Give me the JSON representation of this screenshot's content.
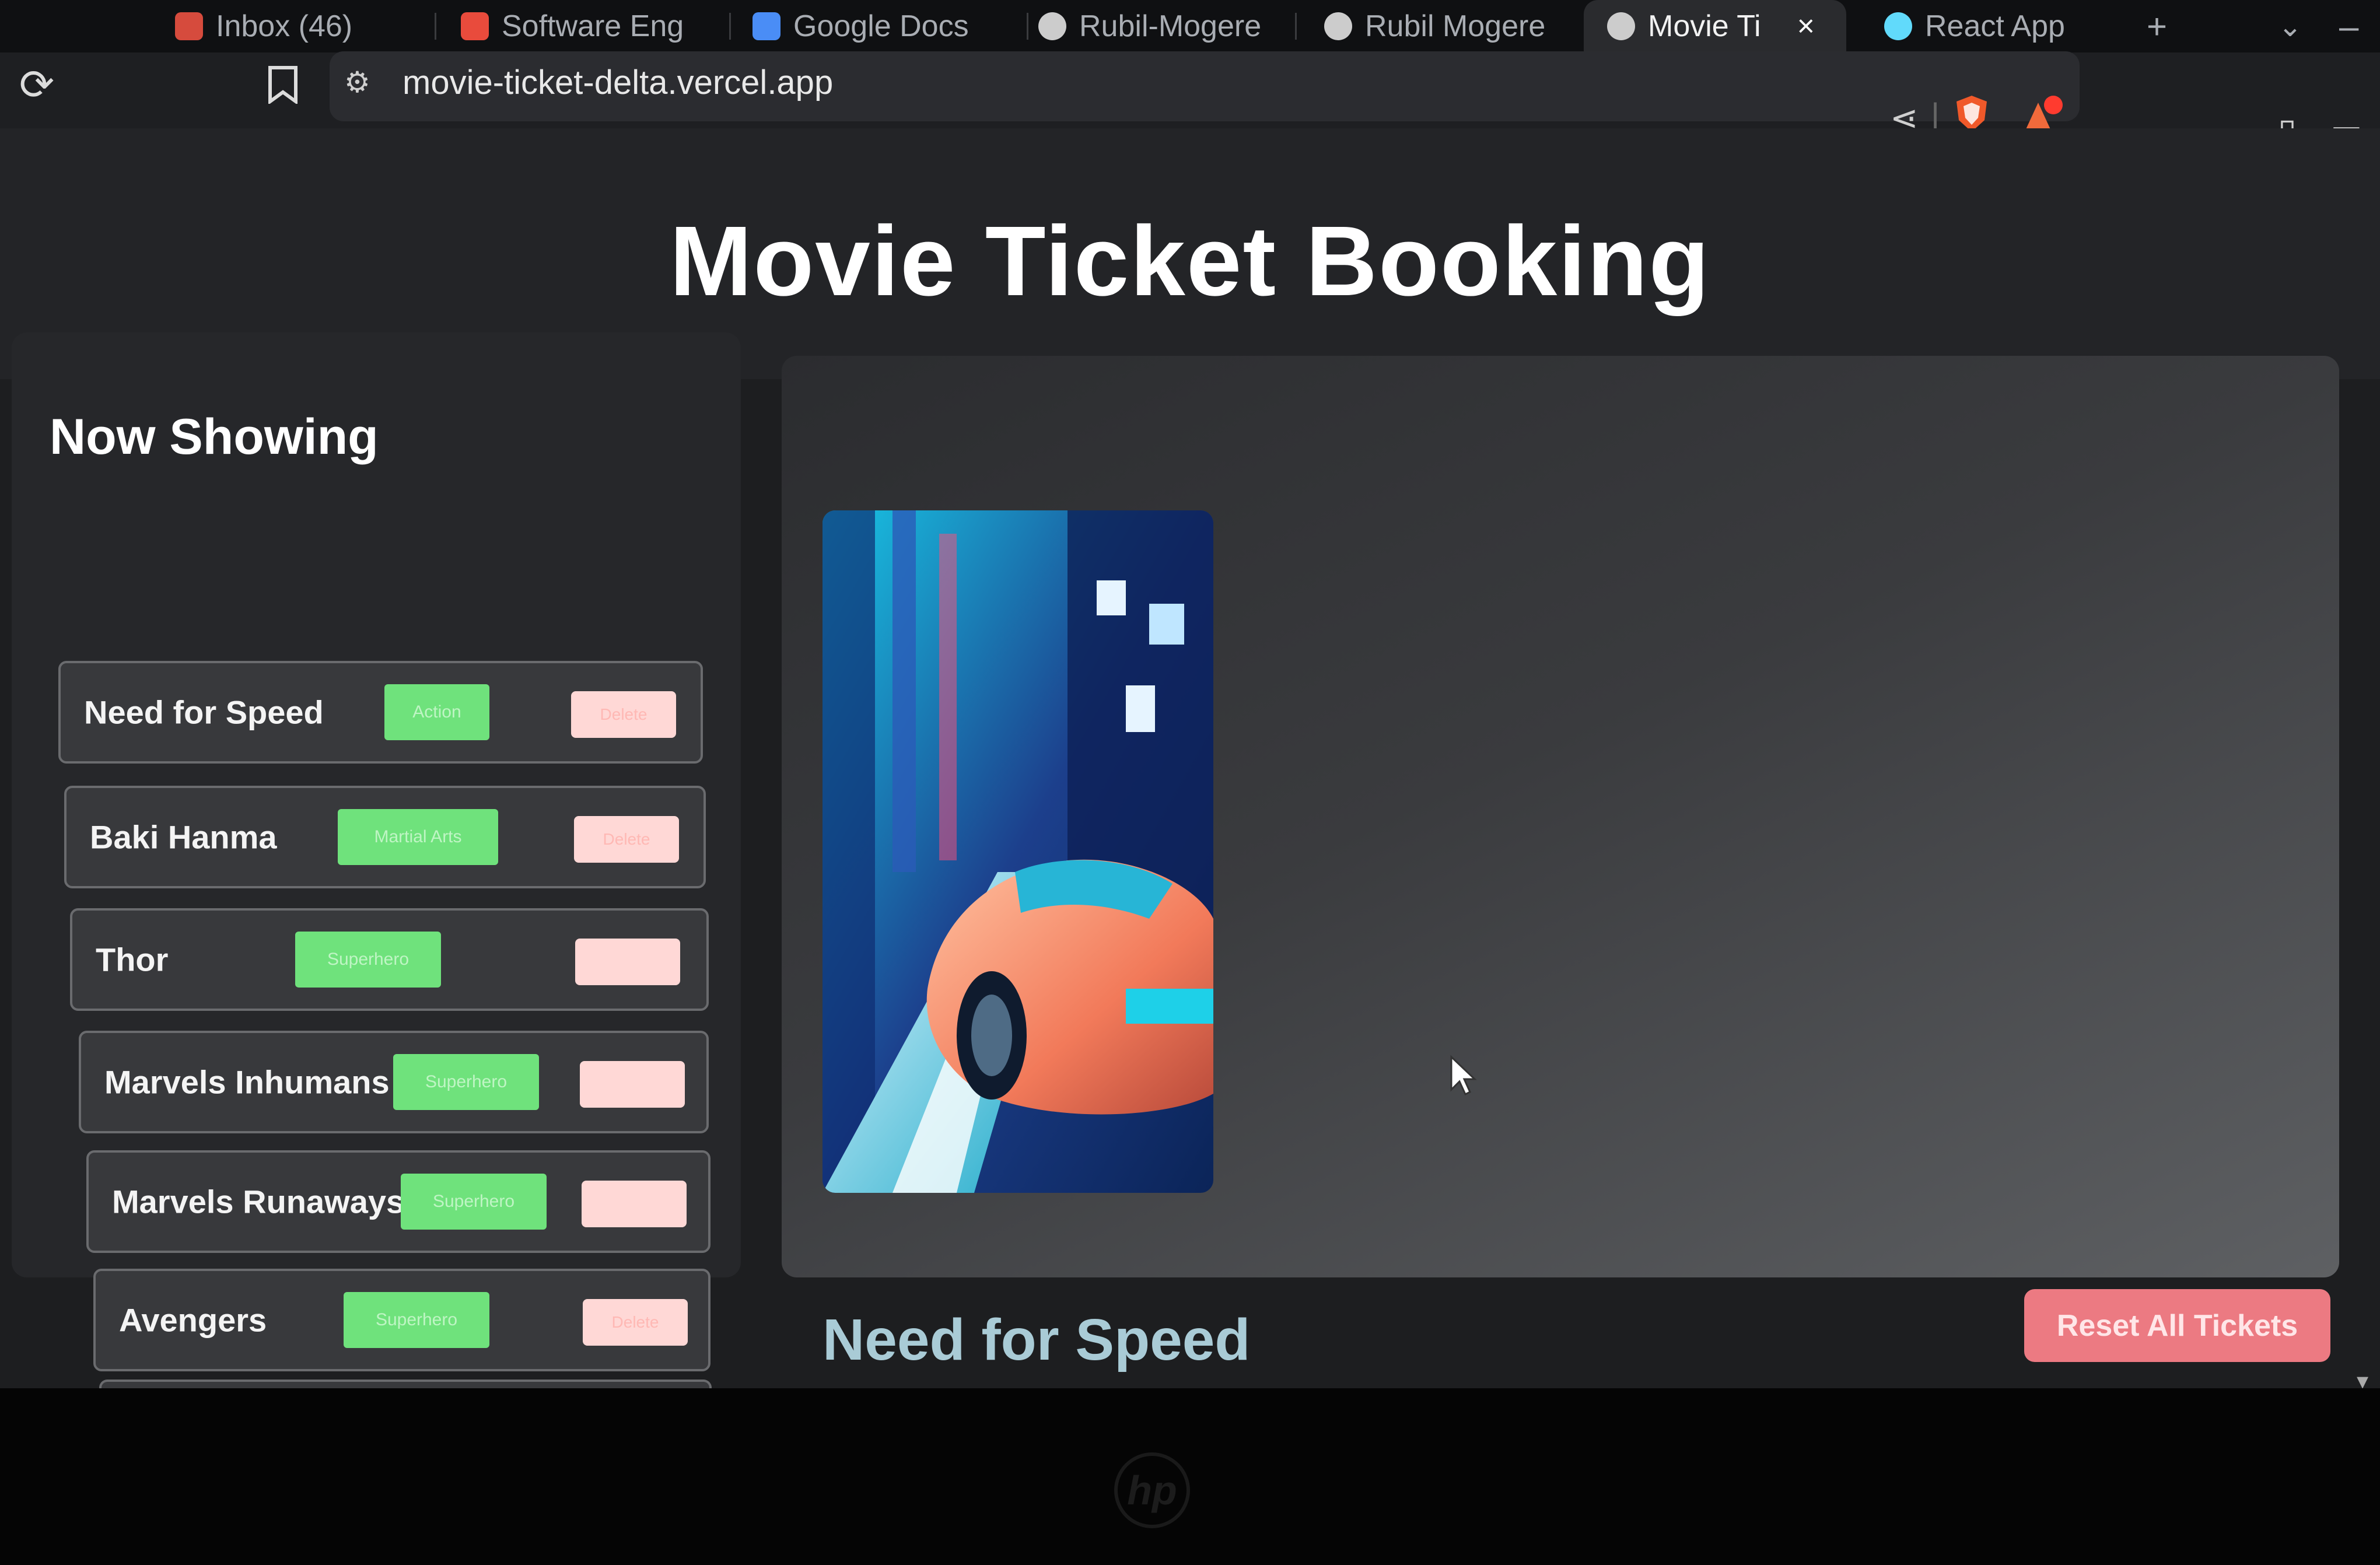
{
  "browser": {
    "tabs": [
      {
        "label": "Inbox (46)",
        "favicon": "gmail-icon",
        "color": "#d64b3d"
      },
      {
        "label": "Software Eng",
        "favicon": "app-icon",
        "color": "#e94b3c"
      },
      {
        "label": "Google Docs",
        "favicon": "docs-icon",
        "color": "#4a8df6"
      },
      {
        "label": "Rubil-Mogere",
        "favicon": "github-icon",
        "color": "#cccccc"
      },
      {
        "label": "Rubil Mogere",
        "favicon": "globe-icon",
        "color": "#cccccc"
      },
      {
        "label": "Movie Ti",
        "favicon": "globe-icon",
        "color": "#cccccc",
        "active": true
      },
      {
        "label": "React App",
        "favicon": "react-icon",
        "color": "#61dafb"
      }
    ],
    "new_tab": "+",
    "close_tab": "×",
    "url": "movie-ticket-delta.vercel.app"
  },
  "page": {
    "title": "Movie Ticket Booking",
    "sidebar_title": "Now Showing",
    "movies": [
      {
        "name": "Need for Speed",
        "genre": "Action",
        "delete": "Delete"
      },
      {
        "name": "Baki Hanma",
        "genre": "Martial Arts",
        "delete": "Delete"
      },
      {
        "name": "Thor",
        "genre": "Superhero",
        "delete": ""
      },
      {
        "name": "Marvels Inhumans",
        "genre": "Superhero",
        "delete": ""
      },
      {
        "name": "Marvels Runaways",
        "genre": "Superhero",
        "delete": ""
      },
      {
        "name": "Avengers",
        "genre": "Superhero",
        "delete": "Delete"
      }
    ],
    "selected_title": "Need for Speed",
    "reset_label": "Reset All Tickets"
  },
  "colors": {
    "genre_badge": "#6fe27c",
    "delete_button": "#ffd8d6",
    "reset_button": "#ec7a82",
    "selected_title": "#a9cbd6"
  }
}
